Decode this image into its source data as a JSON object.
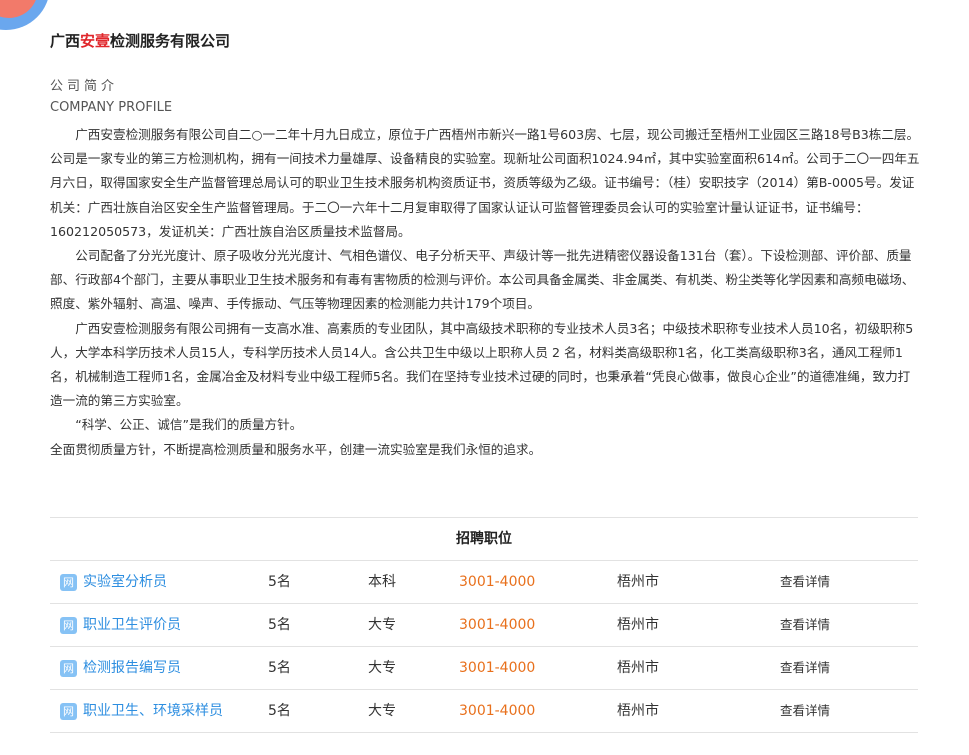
{
  "header": {
    "company_prefix": "广西",
    "company_accent": "安壹",
    "company_suffix": "检测服务有限公司"
  },
  "profile": {
    "label_cn": "公司简介",
    "label_en": "COMPANY PROFILE",
    "paragraphs": [
      "广西安壹检测服务有限公司自二○一二年十月九日成立，原位于广西梧州市新兴一路1号603房、七层，现公司搬迁至梧州工业园区三路18号B3栋二层。公司是一家专业的第三方检测机构，拥有一间技术力量雄厚、设备精良的实验室。现新址公司面积1024.94㎡，其中实验室面积614㎡。公司于二〇一四年五月六日，取得国家安全生产监督管理总局认可的职业卫生技术服务机构资质证书，资质等级为乙级。证书编号：（桂）安职技字（2014）第B-0005号。发证机关：广西壮族自治区安全生产监督管理局。于二〇一六年十二月复审取得了国家认证认可监督管理委员会认可的实验室计量认证证书，证书编号：160212050573，发证机关：广西壮族自治区质量技术监督局。",
      "公司配备了分光光度计、原子吸收分光光度计、气相色谱仪、电子分析天平、声级计等一批先进精密仪器设备131台（套）。下设检测部、评价部、质量部、行政部4个部门，主要从事职业卫生技术服务和有毒有害物质的检测与评价。本公司具备金属类、非金属类、有机类、粉尘类等化学因素和高频电磁场、照度、紫外辐射、高温、噪声、手传振动、气压等物理因素的检测能力共计179个项目。",
      "广西安壹检测服务有限公司拥有一支高水准、高素质的专业团队，其中高级技术职称的专业技术人员3名；中级技术职称专业技术人员10名，初级职称5人，大学本科学历技术人员15人，专科学历技术人员14人。含公共卫生中级以上职称人员 2 名，材料类高级职称1名，化工类高级职称3名，通风工程师1名，机械制造工程师1名，金属冶金及材料专业中级工程师5名。我们在坚持专业技术过硬的同时，也秉承着“凭良心做事，做良心企业”的道德准绳，致力打造一流的第三方实验室。",
      "“科学、公正、诚信”是我们的质量方针。",
      "全面贯彻质量方针，不断提高检测质量和服务水平，创建一流实验室是我们永恒的追求。"
    ]
  },
  "jobs": {
    "heading": "招聘职位",
    "icon_glyph": "网",
    "rows": [
      {
        "title": "实验室分析员",
        "count": "5名",
        "education": "本科",
        "salary": "3001-4000",
        "city": "梧州市",
        "detail": "查看详情"
      },
      {
        "title": "职业卫生评价员",
        "count": "5名",
        "education": "大专",
        "salary": "3001-4000",
        "city": "梧州市",
        "detail": "查看详情"
      },
      {
        "title": "检测报告编写员",
        "count": "5名",
        "education": "大专",
        "salary": "3001-4000",
        "city": "梧州市",
        "detail": "查看详情"
      },
      {
        "title": "职业卫生、环境采样员",
        "count": "5名",
        "education": "大专",
        "salary": "3001-4000",
        "city": "梧州市",
        "detail": "查看详情"
      }
    ]
  },
  "colors": {
    "accent_red": "#e0262b",
    "link_blue": "#2d8ee0",
    "salary_orange": "#e8701c"
  }
}
